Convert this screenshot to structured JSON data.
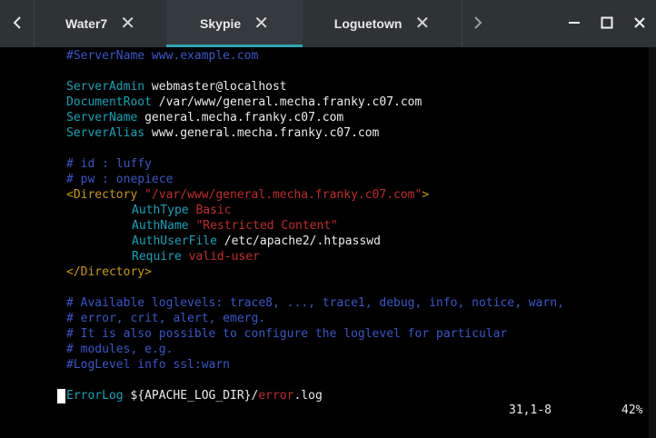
{
  "titlebar": {
    "back_icon": "chevron-left-icon",
    "forward_icon": "chevron-right-icon",
    "tabs": [
      {
        "label": "Water7",
        "close": "✕"
      },
      {
        "label": "Skypie",
        "close": "✕"
      },
      {
        "label": "Loguetown",
        "close": "✕"
      }
    ],
    "active_tab": "Skypie",
    "accent_color": "#2ea3b5",
    "minimize": "—",
    "maximize": "□",
    "close": "✕"
  },
  "terminal": {
    "l1": "#ServerName www.example.com",
    "l2_key": "ServerAdmin",
    "l2_val": " webmaster@localhost",
    "l3_key": "DocumentRoot",
    "l3_val": " /var/www/general.mecha.franky.c07.com",
    "l4_key": "ServerName",
    "l4_val": " general.mecha.franky.c07.com",
    "l5_key": "ServerAlias",
    "l5_val": " www.general.mecha.franky.c07.com",
    "l6": "# id : luffy",
    "l7": "# pw : onepiece",
    "l8_open": "<Directory ",
    "l8_path": "\"/var/www/general.mecha.franky.c07.com\"",
    "l8_close": ">",
    "l9_key": "AuthType",
    "l9_val": " Basic",
    "l10_key": "AuthName",
    "l10_val": " \"Restricted Content\"",
    "l11_key": "AuthUserFile",
    "l11_val": " /etc/apache2/.htpasswd",
    "l12_key": "Require",
    "l12_val": " valid-user",
    "l13": "</Directory>",
    "l14": "# Available loglevels: trace8, ..., trace1, debug, info, notice, warn,",
    "l15": "# error, crit, alert, emerg.",
    "l16": "# It is also possible to configure the loglevel for particular",
    "l17": "# modules, e.g.",
    "l18": "#LogLevel info ssl:warn",
    "l19_key": "ErrorLog",
    "l19_mid": " ${APACHE_LOG_DIR}/",
    "l19_err": "error",
    "l19_end": ".log",
    "status_position": "31,1-8",
    "status_percent": "42%",
    "colors": {
      "comment": "#3a56c8",
      "directive": "#12a3b8",
      "tag": "#c99a0d",
      "string": "#c12a2a"
    }
  }
}
